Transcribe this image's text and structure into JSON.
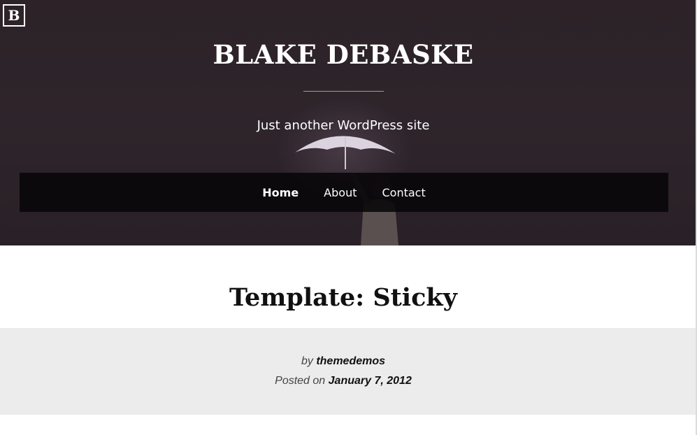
{
  "logo": {
    "letter": "B"
  },
  "site": {
    "title": "BLAKE DEBASKE",
    "tagline": "Just another WordPress site"
  },
  "nav": {
    "items": [
      {
        "label": "Home",
        "active": true
      },
      {
        "label": "About",
        "active": false
      },
      {
        "label": "Contact",
        "active": false
      }
    ]
  },
  "post": {
    "title": "Template: Sticky",
    "by_prefix": "by",
    "author": "themedemos",
    "posted_prefix": "Posted on",
    "date": "January 7, 2012"
  },
  "colors": {
    "hero_bg": "#2c2228",
    "nav_bg": "#080608",
    "meta_bg": "#ececec",
    "text_dark": "#111111"
  }
}
